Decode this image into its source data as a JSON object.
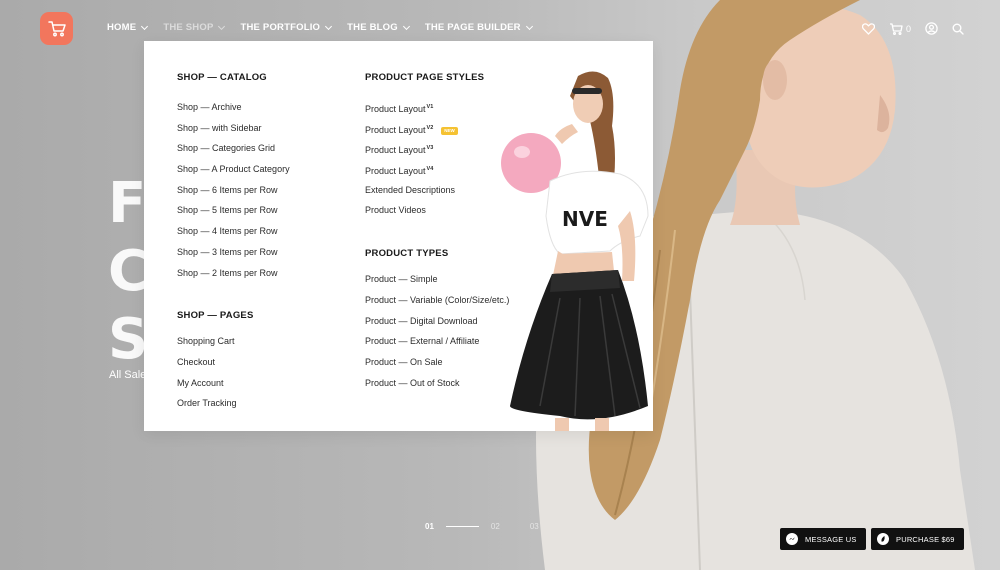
{
  "header": {
    "nav": [
      {
        "label": "HOME",
        "dim": false
      },
      {
        "label": "THE SHOP",
        "dim": true
      },
      {
        "label": "THE PORTFOLIO",
        "dim": false
      },
      {
        "label": "THE BLOG",
        "dim": false
      },
      {
        "label": "THE PAGE BUILDER",
        "dim": false
      }
    ],
    "cart_count": "0"
  },
  "hero": {
    "heading": "Fa\nC\nSc",
    "subtext": "All Sale"
  },
  "mega_menu": {
    "catalog": {
      "heading": "SHOP — CATALOG",
      "items": [
        "Shop — Archive",
        "Shop — with Sidebar",
        "Shop — Categories Grid",
        "Shop — A Product Category",
        "Shop — 6 Items per Row",
        "Shop — 5 Items per Row",
        "Shop — 4 Items per Row",
        "Shop — 3 Items per Row",
        "Shop — 2 Items per Row"
      ]
    },
    "pages": {
      "heading": "SHOP — PAGES",
      "items": [
        "Shopping Cart",
        "Checkout",
        "My Account",
        "Order Tracking"
      ]
    },
    "product_page_styles": {
      "heading": "PRODUCT PAGE STYLES",
      "layouts": [
        {
          "label": "Product Layout",
          "version": "V1",
          "badge": ""
        },
        {
          "label": "Product Layout",
          "version": "V2",
          "badge": "NEW"
        },
        {
          "label": "Product Layout",
          "version": "V3",
          "badge": ""
        },
        {
          "label": "Product Layout",
          "version": "V4",
          "badge": ""
        }
      ],
      "extra_items": [
        "Extended Descriptions",
        "Product Videos"
      ]
    },
    "product_types": {
      "heading": "PRODUCT TYPES",
      "items": [
        "Product — Simple",
        "Product — Variable (Color/Size/etc.)",
        "Product — Digital Download",
        "Product — External / Affiliate",
        "Product — On Sale",
        "Product — Out of Stock"
      ]
    }
  },
  "pager": {
    "pages": [
      "01",
      "02",
      "03"
    ],
    "active": "01"
  },
  "buttons": {
    "message": "MESSAGE US",
    "purchase": "PURCHASE $69"
  },
  "colors": {
    "brand": "#f2765d",
    "badge": "#f5c232",
    "dark_button": "#111111"
  }
}
